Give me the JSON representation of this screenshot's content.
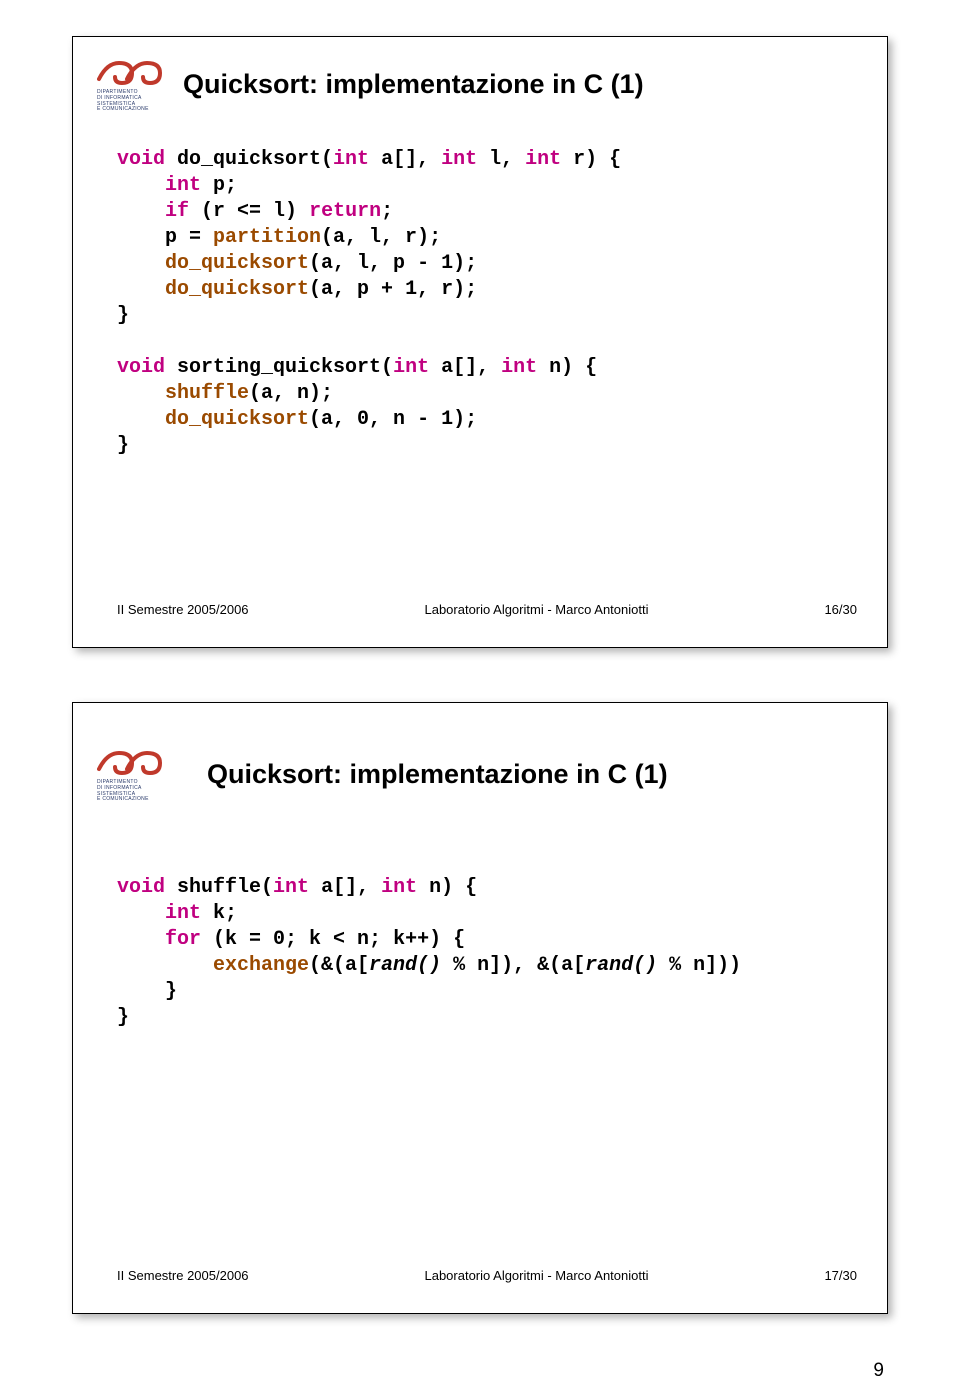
{
  "slide1": {
    "title": "Quicksort: implementazione in C (1)",
    "footer_left": "II Semestre 2005/2006",
    "footer_center": "Laboratorio Algoritmi - Marco Antoniotti",
    "footer_right": "16/30",
    "code": {
      "l1a": "void",
      "l1b": " do_quicksort(",
      "l1c": "int",
      "l1d": " a[], ",
      "l1e": "int",
      "l1f": " l, ",
      "l1g": "int",
      "l1h": " r) {",
      "l2a": "    ",
      "l2b": "int",
      "l2c": " p;",
      "l3a": "    ",
      "l3b": "if",
      "l3c": " (r <= l) ",
      "l3d": "return",
      "l3e": ";",
      "l4a": "    p = ",
      "l4b": "partition",
      "l4c": "(a, l, r);",
      "l5a": "    ",
      "l5b": "do_quicksort",
      "l5c": "(a, l, p - 1);",
      "l6a": "    ",
      "l6b": "do_quicksort",
      "l6c": "(a, p + 1, r);",
      "l7": "}",
      "blank": "",
      "l8a": "void",
      "l8b": " sorting_quicksort(",
      "l8c": "int",
      "l8d": " a[], ",
      "l8e": "int",
      "l8f": " n) {",
      "l9a": "    ",
      "l9b": "shuffle",
      "l9c": "(a, n);",
      "l10a": "    ",
      "l10b": "do_quicksort",
      "l10c": "(a, 0, n - 1);",
      "l11": "}"
    }
  },
  "slide2": {
    "title": "Quicksort: implementazione in C (1)",
    "footer_left": "II Semestre 2005/2006",
    "footer_center": "Laboratorio Algoritmi - Marco Antoniotti",
    "footer_right": "17/30",
    "code": {
      "l1a": "void",
      "l1b": " shuffle(",
      "l1c": "int",
      "l1d": " a[], ",
      "l1e": "int",
      "l1f": " n) {",
      "l2a": "    ",
      "l2b": "int",
      "l2c": " k;",
      "l3a": "    ",
      "l3b": "for",
      "l3c": " (k = 0; k < n; k++) {",
      "l4a": "        ",
      "l4b": "exchange",
      "l4c": "(&(a[",
      "l4d": "rand()",
      "l4e": " % n]), &(a[",
      "l4f": "rand()",
      "l4g": " % n]))",
      "l5": "    }",
      "l6": "}"
    }
  },
  "logo": {
    "line1": "DIPARTIMENTO",
    "line2": "DI INFORMATICA",
    "line3": "SISTEMISTICA",
    "line4": "E COMUNICAZIONE"
  },
  "pagenum": "9"
}
